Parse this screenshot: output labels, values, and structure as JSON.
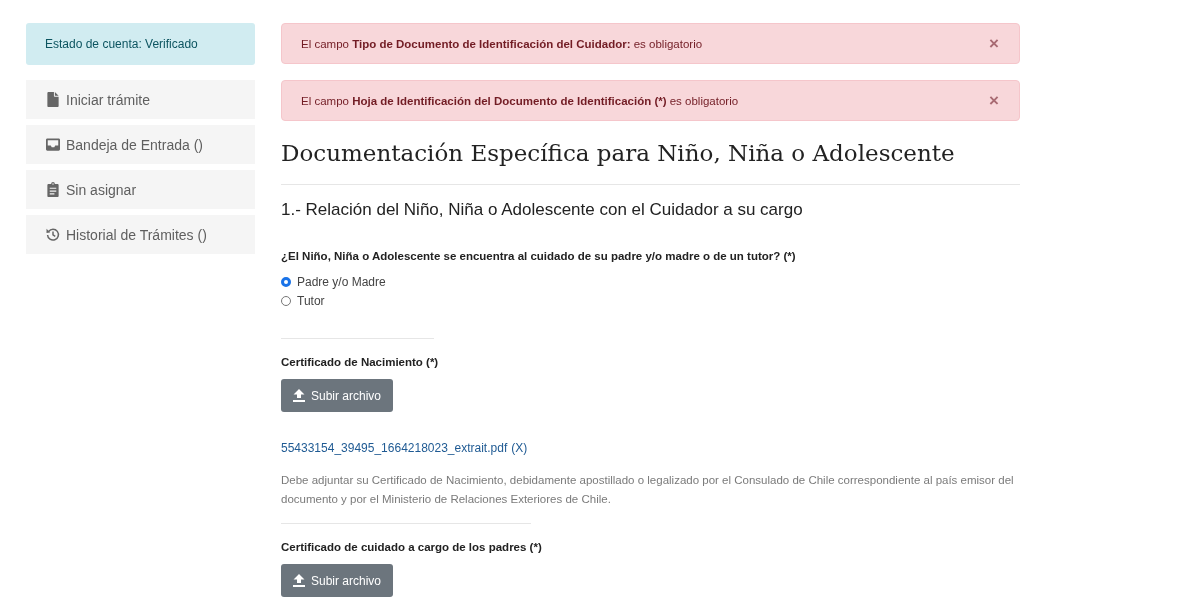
{
  "sidebar": {
    "status": "Estado de cuenta: Verificado",
    "items": [
      {
        "label": "Iniciar trámite"
      },
      {
        "label": "Bandeja de Entrada ()"
      },
      {
        "label": "Sin asignar"
      },
      {
        "label": "Historial de Trámites ()"
      }
    ]
  },
  "alerts": [
    {
      "text": "El campo **Tipo de Documento de Identificación del Cuidador:** es obligatorio",
      "close": "×"
    },
    {
      "text": "El campo **Hoja de Identificación del Documento de Identificación (*)** es obligatorio",
      "close": "×"
    }
  ],
  "page_title": "Documentación Específica para Niño, Niña o Adolescente",
  "section_title": "1.- Relación del Niño, Niña o Adolescente con el Cuidador a su cargo",
  "question": {
    "label": "¿El Niño, Niña o Adolescente se encuentra al cuidado de su padre y/o madre o de un tutor? (*)",
    "options": [
      {
        "label": "Padre y/o Madre",
        "selected": true
      },
      {
        "label": "Tutor",
        "selected": false
      }
    ]
  },
  "uploads": [
    {
      "label": "Certificado de Nacimiento (*)",
      "button": "Subir archivo",
      "file": {
        "name": "55433154_39495_1664218023_extrait.pdf",
        "remove": "(X)"
      },
      "help": "Debe adjuntar su Certificado de Nacimiento, debidamente apostillado o legalizado por el Consulado de Chile correspondiente al país emisor del documento y por el Ministerio de Relaciones Exteriores de Chile."
    },
    {
      "label": "Certificado de cuidado a cargo de los padres (*)",
      "button": "Subir archivo"
    }
  ]
}
